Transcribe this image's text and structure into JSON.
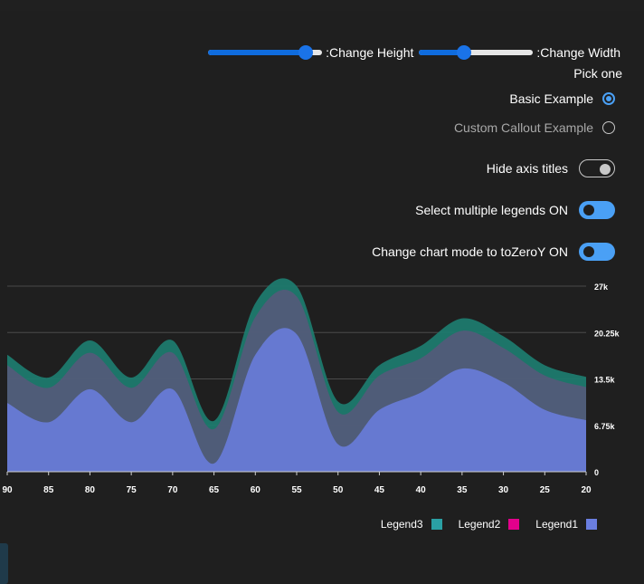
{
  "controls": {
    "height_slider": {
      "label": ":Change Height",
      "value": 0.86
    },
    "width_slider": {
      "label": ":Change Width",
      "value": 0.39
    },
    "pick_one_label": "Pick one",
    "radio_options": [
      {
        "label": "Basic Example",
        "checked": true
      },
      {
        "label": "Custom Callout Example",
        "checked": false
      }
    ],
    "toggles": [
      {
        "label": "Hide axis titles",
        "on": false
      },
      {
        "label": "Select multiple legends ON",
        "on": true
      },
      {
        "label": "Change chart mode to toZeroY ON",
        "on": true
      }
    ]
  },
  "colors": {
    "legend1": "#6a7ee0",
    "legend2": "#e3008c",
    "legend3": "#2aa0a4",
    "accent": "#4aa0f5"
  },
  "chart_data": {
    "type": "area",
    "stacked": true,
    "x": [
      90,
      85,
      80,
      75,
      70,
      65,
      60,
      55,
      50,
      45,
      40,
      35,
      30,
      25,
      20
    ],
    "x_reversed": true,
    "x_ticks": [
      "90",
      "85",
      "80",
      "75",
      "70",
      "65",
      "60",
      "55",
      "50",
      "45",
      "40",
      "35",
      "30",
      "25",
      "20"
    ],
    "y_ticks": [
      "0",
      "6.75k",
      "13.5k",
      "20.25k",
      "27k"
    ],
    "ylim": [
      0,
      27000
    ],
    "y_axis_position": "right",
    "grid": true,
    "series": [
      {
        "name": "Legend1",
        "values": [
          10000,
          7200,
          12000,
          7200,
          12000,
          1200,
          17000,
          20000,
          4000,
          9000,
          11500,
          15000,
          13000,
          9000,
          7500
        ]
      },
      {
        "name": "Legend2",
        "values": [
          5500,
          5000,
          5300,
          5000,
          5300,
          5000,
          5500,
          5500,
          4700,
          5000,
          5000,
          5500,
          5000,
          5000,
          4800
        ]
      },
      {
        "name": "Legend3",
        "values": [
          1500,
          1500,
          1800,
          1500,
          1800,
          1200,
          2000,
          1500,
          1500,
          1500,
          1800,
          1800,
          1700,
          1500,
          1500
        ]
      }
    ],
    "legend": [
      "Legend3",
      "Legend2",
      "Legend1"
    ],
    "legend_position": "bottom-right"
  }
}
